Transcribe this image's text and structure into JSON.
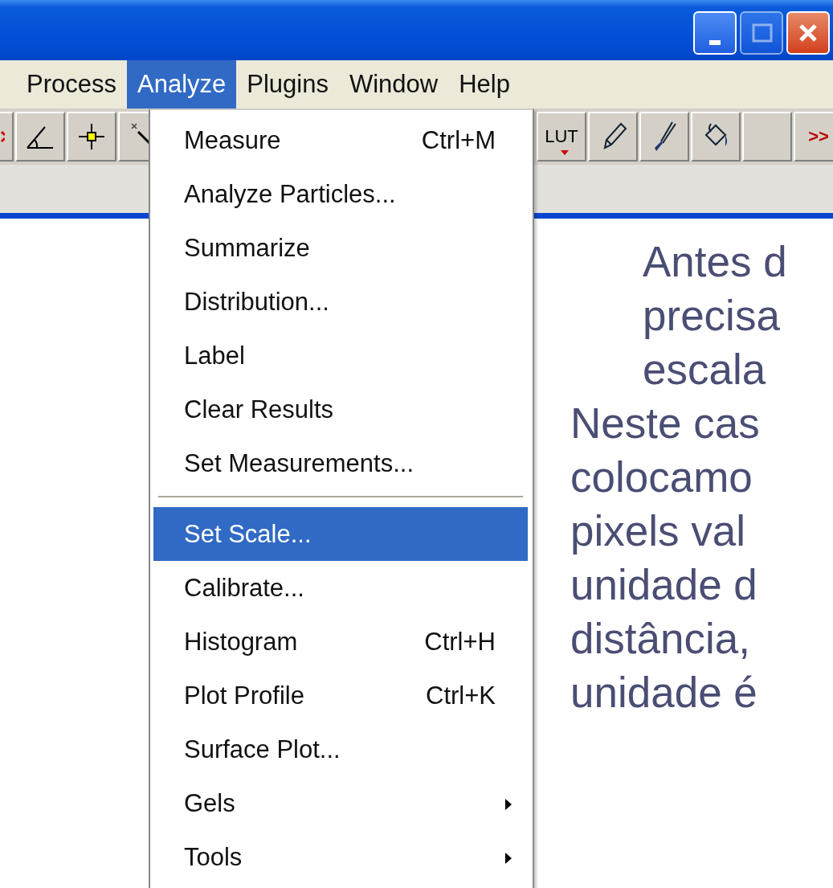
{
  "window": {
    "controls": [
      {
        "kind": "minimize",
        "disabled": false
      },
      {
        "kind": "maximize",
        "disabled": true
      },
      {
        "kind": "close",
        "disabled": false
      }
    ]
  },
  "menubar": [
    {
      "label": "Process",
      "selected": false
    },
    {
      "label": "Analyze",
      "selected": true
    },
    {
      "label": "Plugins",
      "selected": false
    },
    {
      "label": "Window",
      "selected": false
    },
    {
      "label": "Help",
      "selected": false
    }
  ],
  "toolbar_left": [
    {
      "kind": "partial"
    },
    {
      "kind": "angle"
    },
    {
      "kind": "point"
    },
    {
      "kind": "wand"
    }
  ],
  "toolbar_right": [
    {
      "kind": "lut",
      "label": "LUT"
    },
    {
      "kind": "pencil"
    },
    {
      "kind": "brush"
    },
    {
      "kind": "bucket"
    },
    {
      "kind": "blank"
    },
    {
      "kind": "more",
      "label": ">>"
    }
  ],
  "menu": [
    {
      "kind": "item",
      "label": "Measure",
      "shortcut": "Ctrl+M",
      "selected": false
    },
    {
      "kind": "item",
      "label": "Analyze Particles...",
      "selected": false
    },
    {
      "kind": "item",
      "label": "Summarize",
      "selected": false
    },
    {
      "kind": "item",
      "label": "Distribution...",
      "selected": false
    },
    {
      "kind": "item",
      "label": "Label",
      "selected": false
    },
    {
      "kind": "item",
      "label": "Clear Results",
      "selected": false
    },
    {
      "kind": "item",
      "label": "Set Measurements...",
      "selected": false
    },
    {
      "kind": "separator"
    },
    {
      "kind": "item",
      "label": "Set Scale...",
      "selected": true
    },
    {
      "kind": "item",
      "label": "Calibrate...",
      "selected": false
    },
    {
      "kind": "item",
      "label": "Histogram",
      "shortcut": "Ctrl+H",
      "selected": false
    },
    {
      "kind": "item",
      "label": "Plot Profile",
      "shortcut": "Ctrl+K",
      "selected": false
    },
    {
      "kind": "item",
      "label": "Surface Plot...",
      "selected": false
    },
    {
      "kind": "submenu",
      "label": "Gels",
      "selected": false
    },
    {
      "kind": "submenu",
      "label": "Tools",
      "selected": false
    }
  ],
  "slide_text": [
    {
      "kind": "indented",
      "lines": [
        "Antes d",
        "precisa",
        "escala"
      ]
    },
    {
      "kind": "plain",
      "lines": [
        "Neste cas",
        "colocamo",
        "pixels val",
        "unidade d",
        "distância,",
        "unidade é"
      ]
    }
  ]
}
